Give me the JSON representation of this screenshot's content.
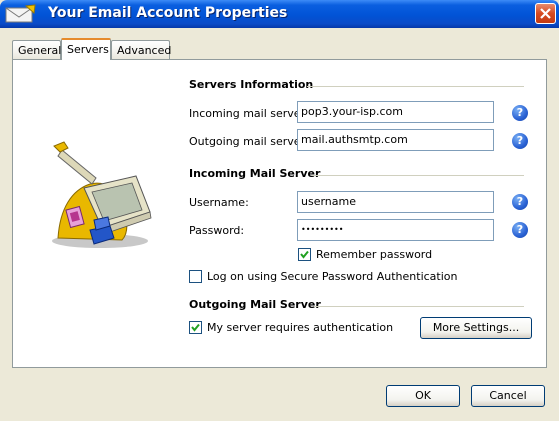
{
  "window": {
    "title": "Your Email Account Properties"
  },
  "tabs": [
    {
      "label": "General"
    },
    {
      "label": "Servers"
    },
    {
      "label": "Advanced"
    }
  ],
  "servers_info": {
    "heading": "Servers Information",
    "incoming_label": "Incoming mail server:",
    "incoming_value": "pop3.your-isp.com",
    "outgoing_label": "Outgoing mail server:",
    "outgoing_value": "mail.authsmtp.com"
  },
  "incoming_mail_server": {
    "heading": "Incoming Mail Server",
    "username_label": "Username:",
    "username_value": "username",
    "password_label": "Password:",
    "password_value": "•••••••••",
    "remember_password_label": "Remember password",
    "remember_password_checked": true,
    "spa_label": "Log on using Secure Password Authentication",
    "spa_checked": false
  },
  "outgoing_mail_server": {
    "heading": "Outgoing Mail Server",
    "requires_auth_label": "My server requires authentication",
    "requires_auth_checked": true,
    "more_settings_label": "More Settings..."
  },
  "footer": {
    "ok_label": "OK",
    "cancel_label": "Cancel"
  },
  "colors": {
    "titlebar": "#0153D6",
    "active_tab_accent": "#E68B2C",
    "dialog_bg": "#ECE9D8"
  },
  "icons": [
    "mail-icon",
    "close-icon",
    "help-icon",
    "checkmark-icon",
    "mail-server-illustration"
  ]
}
